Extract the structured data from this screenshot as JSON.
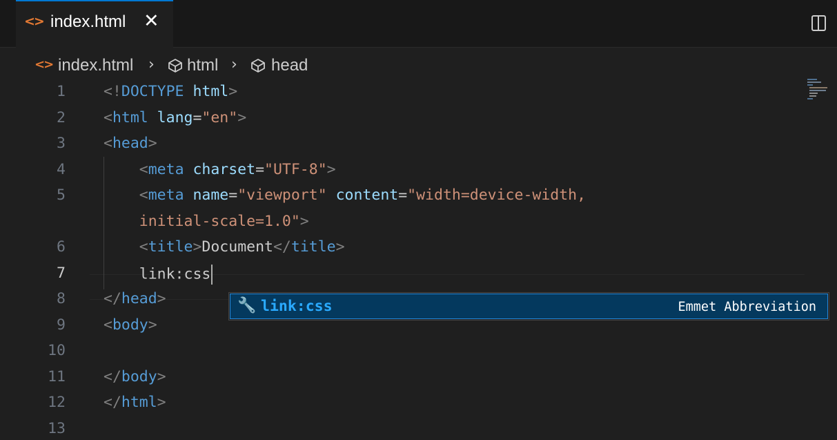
{
  "tab": {
    "icon": "html-file-icon",
    "icon_glyph": "<>",
    "title": "index.html",
    "close_glyph": "✕"
  },
  "actions": {
    "split_editor_icon": "split-editor-icon"
  },
  "breadcrumb": {
    "file_icon_glyph": "<>",
    "file": "index.html",
    "separator": "›",
    "items": [
      "html",
      "head"
    ]
  },
  "editor": {
    "active_line": 7,
    "lines": [
      {
        "n": "1",
        "segments": [
          {
            "t": "<!",
            "c": "p"
          },
          {
            "t": "DOCTYPE",
            "c": "t"
          },
          {
            "t": " html",
            "c": "a"
          },
          {
            "t": ">",
            "c": "p"
          }
        ]
      },
      {
        "n": "2",
        "segments": [
          {
            "t": "<",
            "c": "p"
          },
          {
            "t": "html",
            "c": "t"
          },
          {
            "t": " lang",
            "c": "a"
          },
          {
            "t": "=",
            "c": "e"
          },
          {
            "t": "\"en\"",
            "c": "s"
          },
          {
            "t": ">",
            "c": "p"
          }
        ]
      },
      {
        "n": "3",
        "segments": [
          {
            "t": "<",
            "c": "p"
          },
          {
            "t": "head",
            "c": "t"
          },
          {
            "t": ">",
            "c": "p"
          }
        ]
      },
      {
        "n": "4",
        "segments": [
          {
            "t": "    <",
            "c": "p"
          },
          {
            "t": "meta",
            "c": "t"
          },
          {
            "t": " charset",
            "c": "a"
          },
          {
            "t": "=",
            "c": "e"
          },
          {
            "t": "\"UTF-8\"",
            "c": "s"
          },
          {
            "t": ">",
            "c": "p"
          }
        ]
      },
      {
        "n": "5",
        "segments": [
          {
            "t": "    <",
            "c": "p"
          },
          {
            "t": "meta",
            "c": "t"
          },
          {
            "t": " name",
            "c": "a"
          },
          {
            "t": "=",
            "c": "e"
          },
          {
            "t": "\"viewport\"",
            "c": "s"
          },
          {
            "t": " content",
            "c": "a"
          },
          {
            "t": "=",
            "c": "e"
          },
          {
            "t": "\"width=device-width,",
            "c": "s"
          }
        ]
      },
      {
        "n": "",
        "segments": [
          {
            "t": "    initial-scale=1.0\"",
            "c": "s"
          },
          {
            "t": ">",
            "c": "p"
          }
        ]
      },
      {
        "n": "6",
        "segments": [
          {
            "t": "    <",
            "c": "p"
          },
          {
            "t": "title",
            "c": "t"
          },
          {
            "t": ">",
            "c": "p"
          },
          {
            "t": "Document",
            "c": "e"
          },
          {
            "t": "</",
            "c": "p"
          },
          {
            "t": "title",
            "c": "t"
          },
          {
            "t": ">",
            "c": "p"
          }
        ]
      },
      {
        "n": "7",
        "segments": [
          {
            "t": "    link:css",
            "c": "e"
          }
        ],
        "caret": true
      },
      {
        "n": "8",
        "segments": [
          {
            "t": "</",
            "c": "p"
          },
          {
            "t": "head",
            "c": "t"
          },
          {
            "t": ">",
            "c": "p"
          }
        ]
      },
      {
        "n": "9",
        "segments": [
          {
            "t": "<",
            "c": "p"
          },
          {
            "t": "body",
            "c": "t"
          },
          {
            "t": ">",
            "c": "p"
          }
        ]
      },
      {
        "n": "10",
        "segments": []
      },
      {
        "n": "11",
        "segments": [
          {
            "t": "</",
            "c": "p"
          },
          {
            "t": "body",
            "c": "t"
          },
          {
            "t": ">",
            "c": "p"
          }
        ]
      },
      {
        "n": "12",
        "segments": [
          {
            "t": "</",
            "c": "p"
          },
          {
            "t": "html",
            "c": "t"
          },
          {
            "t": ">",
            "c": "p"
          }
        ]
      },
      {
        "n": "13",
        "segments": []
      }
    ]
  },
  "suggestion": {
    "icon": "wrench-icon",
    "icon_glyph": "🔧",
    "label": "link:css",
    "detail": "Emmet Abbreviation"
  },
  "colors": {
    "editor_background": "#1f1f1f",
    "tab_accent": "#0078d4",
    "html_icon": "#e37933",
    "tag": "#569cd6",
    "attribute": "#9cdcfe",
    "string": "#ce9178",
    "suggestion_selected": "#04395e",
    "suggestion_label": "#2aaaff"
  }
}
